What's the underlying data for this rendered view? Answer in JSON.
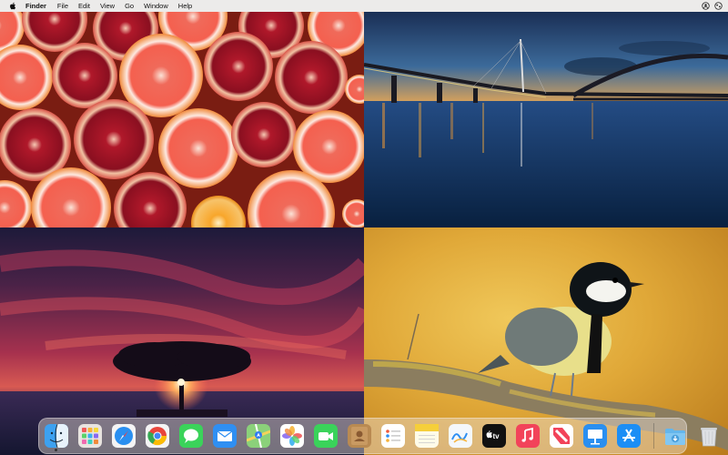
{
  "menubar": {
    "apple_icon": "apple-icon",
    "items": [
      "Finder",
      "File",
      "Edit",
      "View",
      "Go",
      "Window",
      "Help"
    ],
    "status_icons": [
      "user-circle-icon",
      "control-center-icon"
    ]
  },
  "wallpaper": {
    "quadrants": [
      "grapefruit-pomegranate-photo",
      "bridge-at-dusk-photo",
      "tree-sunset-photo",
      "great-tit-bird-photo"
    ]
  },
  "dock": {
    "apps": [
      {
        "name": "Finder",
        "icon": "finder-icon",
        "running": true
      },
      {
        "name": "Launchpad",
        "icon": "launchpad-icon"
      },
      {
        "name": "Safari",
        "icon": "safari-icon"
      },
      {
        "name": "Chrome",
        "icon": "chrome-icon"
      },
      {
        "name": "Messages",
        "icon": "messages-icon"
      },
      {
        "name": "Mail",
        "icon": "mail-icon"
      },
      {
        "name": "Maps",
        "icon": "maps-icon"
      },
      {
        "name": "Photos",
        "icon": "photos-icon"
      },
      {
        "name": "FaceTime",
        "icon": "facetime-icon"
      },
      {
        "name": "Contacts",
        "icon": "contacts-icon"
      },
      {
        "name": "Reminders",
        "icon": "reminders-icon"
      },
      {
        "name": "Notes",
        "icon": "notes-icon"
      },
      {
        "name": "Freeform",
        "icon": "freeform-icon"
      },
      {
        "name": "TV",
        "icon": "tv-icon",
        "label": "tv"
      },
      {
        "name": "Music",
        "icon": "music-icon"
      },
      {
        "name": "News",
        "icon": "news-icon"
      },
      {
        "name": "Keynote",
        "icon": "keynote-icon"
      },
      {
        "name": "App Store",
        "icon": "app-store-icon"
      }
    ],
    "extras": [
      {
        "name": "Downloads",
        "icon": "downloads-folder-icon"
      },
      {
        "name": "Trash",
        "icon": "trash-icon"
      }
    ],
    "colors": {
      "dock_bg": "#ebe1d7"
    }
  }
}
